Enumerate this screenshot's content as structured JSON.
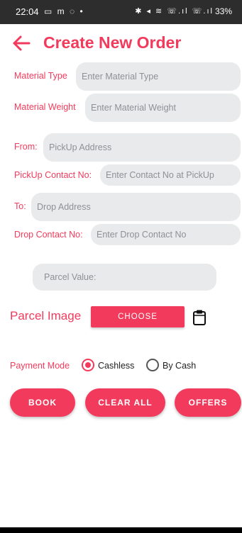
{
  "status_bar": {
    "time": "22:04",
    "left_icons": "▭ m ◌ •",
    "right_icons": "✱ ◂ ≋ ☏.ıl ☏.ıl",
    "battery": "33%"
  },
  "header": {
    "back_icon": "arrow-left-icon",
    "title": "Create New Order"
  },
  "form": {
    "material_type": {
      "label": "Material Type",
      "placeholder": "Enter Material Type",
      "value": ""
    },
    "material_weight": {
      "label": "Material Weight",
      "placeholder": "Enter Material Weight",
      "value": ""
    },
    "from": {
      "label": "From:",
      "placeholder": "PickUp Address",
      "value": ""
    },
    "pickup_contact": {
      "label": "PickUp Contact No:",
      "placeholder": "Enter Contact No at PickUp",
      "value": ""
    },
    "to": {
      "label": "To:",
      "placeholder": "Drop Address",
      "value": ""
    },
    "drop_contact": {
      "label": "Drop Contact No:",
      "placeholder": "Enter Drop Contact No",
      "value": ""
    },
    "parcel_value": {
      "placeholder": "Parcel Value:",
      "value": ""
    }
  },
  "parcel_image": {
    "label": "Parcel Image",
    "choose_label": "CHOOSE",
    "icon": "clipboard-icon"
  },
  "payment": {
    "label": "Payment Mode",
    "options": [
      {
        "label": "Cashless",
        "selected": true
      },
      {
        "label": "By Cash",
        "selected": false
      }
    ]
  },
  "actions": {
    "book": "BOOK",
    "clear_all": "CLEAR ALL",
    "offers": "OFFERS"
  },
  "colors": {
    "accent": "#f23b5c",
    "field_bg": "#e9eaeb",
    "status_bar_bg": "#2d2d2d"
  }
}
